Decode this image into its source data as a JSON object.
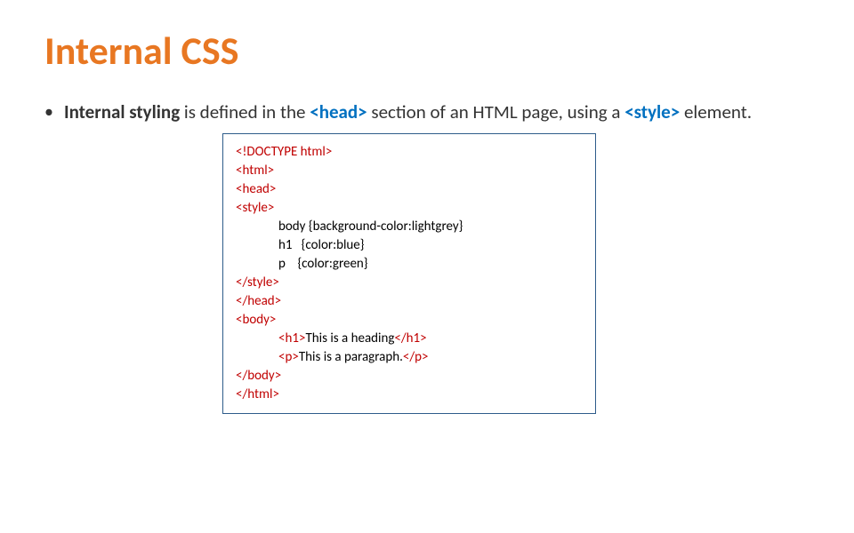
{
  "title": "Internal CSS",
  "bullet": {
    "part1_bold": "Internal styling",
    "part2": " is defined in the ",
    "tag1": "<head>",
    "part3": " section of an HTML page, using a ",
    "tag2": "<style>",
    "part4": " element."
  },
  "code": {
    "l1": "<!DOCTYPE html>",
    "l2": "<html>",
    "l3": "<head>",
    "l4": "<style>",
    "l5": "body {background-color:lightgrey}",
    "l6": "h1   {color:blue}",
    "l7": "p    {color:green}",
    "l8": "</style>",
    "l9": "</head>",
    "l10": "<body>",
    "l11": "<h1>",
    "l11b": "This is a heading",
    "l11c": "</h1>",
    "l12": "<p>",
    "l12b": "This is a paragraph.",
    "l12c": "</p>",
    "l13": "</body>",
    "l14": "</html>"
  }
}
